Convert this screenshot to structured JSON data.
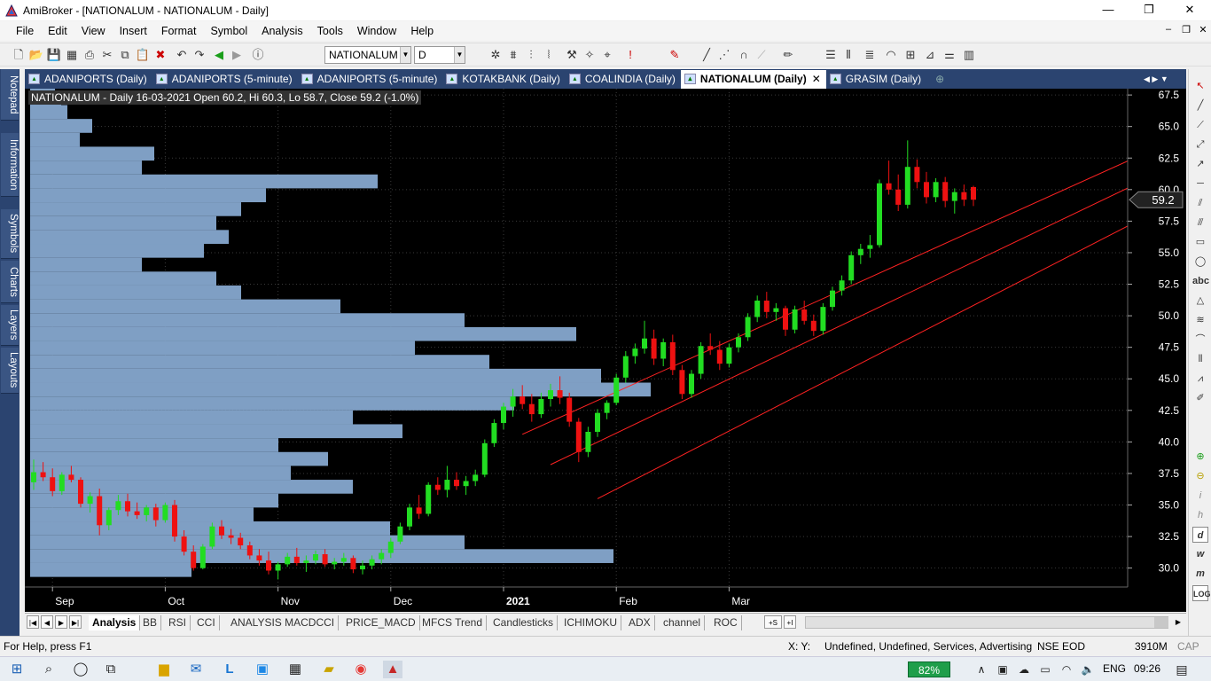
{
  "window": {
    "title": "AmiBroker - [NATIONALUM - NATIONALUM - Daily]",
    "minimize": "—",
    "maximize": "❐",
    "close": "✕"
  },
  "menu": [
    "File",
    "Edit",
    "View",
    "Insert",
    "Format",
    "Symbol",
    "Analysis",
    "Tools",
    "Window",
    "Help"
  ],
  "toolbar": {
    "symbol_value": "NATIONALUM",
    "interval_value": "D"
  },
  "left_panels": [
    "Notepad",
    "Information",
    "Symbols",
    "Charts",
    "Layouts",
    "Layers"
  ],
  "doc_tabs": [
    {
      "label": "ADANIPORTS (Daily)",
      "active": false
    },
    {
      "label": "ADANIPORTS (5-minute)",
      "active": false
    },
    {
      "label": "ADANIPORTS (5-minute)",
      "active": false
    },
    {
      "label": "KOTAKBANK (Daily)",
      "active": false
    },
    {
      "label": "COALINDIA (Daily)",
      "active": false
    },
    {
      "label": "NATIONALUM (Daily)",
      "active": true
    },
    {
      "label": "GRASIM (Daily)",
      "active": false
    }
  ],
  "chart": {
    "header": "NATIONALUM - Daily 16-03-2021 Open 60.2, Hi 60.3, Lo 58.7, Close 59.2 (-1.0%)",
    "last_price_label": "59.2"
  },
  "chart_data": {
    "type": "candlestick",
    "symbol": "NATIONALUM",
    "interval": "Daily",
    "ylim": [
      28.5,
      68.0
    ],
    "yticks": [
      30.0,
      32.5,
      35.0,
      37.5,
      40.0,
      42.5,
      45.0,
      47.5,
      50.0,
      52.5,
      55.0,
      57.5,
      60.0,
      62.5,
      65.0,
      67.5
    ],
    "ytick_labels": [
      "30.0",
      "32.5",
      "35.0",
      "37.5",
      "40.0",
      "42.5",
      "45.0",
      "47.5",
      "50.0",
      "52.5",
      "55.0",
      "57.5",
      "60.0",
      "62.5",
      "65.0",
      "67.5"
    ],
    "xtick_labels": [
      "Sep",
      "Oct",
      "Nov",
      "Dec",
      "2021",
      "Feb",
      "Mar"
    ],
    "xtick_bar_index": [
      2,
      14,
      26,
      38,
      50,
      62,
      74
    ],
    "last_close": 59.2,
    "grid": true,
    "colors": {
      "up": "#22dd22",
      "down": "#ee1111",
      "volume_profile": "#7f9fc4",
      "trend": "#ff2222",
      "background": "#000000"
    },
    "candles": [
      [
        36.8,
        38.6,
        36.2,
        37.6
      ],
      [
        37.6,
        38.4,
        36.9,
        37.2
      ],
      [
        37.2,
        37.9,
        35.7,
        36.1
      ],
      [
        36.1,
        37.6,
        35.8,
        37.4
      ],
      [
        37.4,
        38.1,
        36.8,
        37.0
      ],
      [
        37.0,
        37.2,
        34.8,
        35.1
      ],
      [
        35.1,
        36.0,
        34.4,
        35.7
      ],
      [
        35.7,
        36.3,
        32.6,
        33.4
      ],
      [
        33.4,
        34.8,
        33.0,
        34.6
      ],
      [
        34.6,
        35.8,
        34.2,
        35.3
      ],
      [
        35.3,
        35.9,
        34.1,
        34.5
      ],
      [
        34.5,
        35.2,
        33.9,
        34.2
      ],
      [
        34.2,
        35.0,
        33.7,
        34.8
      ],
      [
        34.8,
        35.1,
        33.3,
        33.8
      ],
      [
        33.8,
        35.2,
        33.6,
        35.0
      ],
      [
        35.0,
        35.4,
        32.1,
        32.5
      ],
      [
        32.5,
        33.0,
        31.0,
        31.3
      ],
      [
        31.3,
        31.8,
        29.8,
        30.0
      ],
      [
        30.0,
        31.9,
        29.9,
        31.7
      ],
      [
        31.7,
        33.6,
        31.5,
        33.3
      ],
      [
        33.3,
        33.8,
        32.3,
        32.6
      ],
      [
        32.6,
        33.1,
        31.9,
        32.4
      ],
      [
        32.4,
        32.8,
        31.5,
        31.8
      ],
      [
        31.8,
        32.1,
        30.7,
        31.0
      ],
      [
        31.0,
        31.5,
        30.2,
        30.6
      ],
      [
        30.6,
        31.3,
        29.5,
        29.8
      ],
      [
        29.8,
        30.5,
        29.1,
        30.3
      ],
      [
        30.3,
        31.2,
        30.1,
        30.9
      ],
      [
        30.9,
        31.6,
        30.2,
        30.4
      ],
      [
        30.4,
        31.0,
        29.7,
        30.6
      ],
      [
        30.6,
        31.4,
        30.3,
        31.1
      ],
      [
        31.1,
        31.5,
        30.1,
        30.3
      ],
      [
        30.3,
        30.8,
        29.9,
        30.5
      ],
      [
        30.5,
        31.2,
        30.2,
        30.8
      ],
      [
        30.8,
        31.0,
        29.6,
        29.9
      ],
      [
        29.9,
        30.6,
        29.5,
        30.2
      ],
      [
        30.2,
        31.0,
        29.9,
        30.7
      ],
      [
        30.7,
        31.5,
        30.3,
        31.2
      ],
      [
        31.2,
        32.4,
        30.8,
        32.1
      ],
      [
        32.1,
        33.6,
        31.9,
        33.3
      ],
      [
        33.3,
        35.1,
        33.0,
        34.8
      ],
      [
        34.8,
        35.8,
        33.9,
        34.3
      ],
      [
        34.3,
        36.8,
        34.1,
        36.6
      ],
      [
        36.6,
        37.2,
        35.8,
        36.2
      ],
      [
        36.2,
        38.1,
        35.6,
        37.0
      ],
      [
        37.0,
        37.6,
        36.2,
        36.5
      ],
      [
        36.5,
        37.3,
        35.8,
        36.9
      ],
      [
        36.9,
        37.8,
        36.5,
        37.4
      ],
      [
        37.4,
        40.2,
        37.2,
        39.9
      ],
      [
        39.9,
        41.8,
        39.6,
        41.5
      ],
      [
        41.5,
        43.1,
        41.0,
        42.8
      ],
      [
        42.8,
        44.2,
        42.0,
        43.6
      ],
      [
        43.6,
        44.5,
        42.6,
        43.0
      ],
      [
        43.0,
        43.8,
        41.6,
        42.2
      ],
      [
        42.2,
        43.9,
        41.9,
        43.4
      ],
      [
        43.4,
        44.6,
        42.8,
        44.1
      ],
      [
        44.1,
        45.2,
        43.0,
        43.5
      ],
      [
        43.5,
        43.9,
        41.2,
        41.6
      ],
      [
        41.6,
        41.9,
        38.4,
        39.2
      ],
      [
        39.2,
        41.2,
        38.8,
        40.8
      ],
      [
        40.8,
        42.6,
        40.4,
        42.3
      ],
      [
        42.3,
        43.3,
        41.8,
        43.1
      ],
      [
        43.1,
        45.4,
        42.9,
        45.1
      ],
      [
        45.1,
        47.2,
        44.7,
        46.8
      ],
      [
        46.8,
        47.8,
        46.2,
        47.4
      ],
      [
        47.4,
        49.6,
        47.0,
        48.2
      ],
      [
        48.2,
        48.9,
        46.1,
        46.6
      ],
      [
        46.6,
        48.2,
        46.0,
        47.9
      ],
      [
        47.9,
        48.5,
        45.3,
        45.7
      ],
      [
        45.7,
        46.1,
        43.4,
        43.8
      ],
      [
        43.8,
        45.7,
        43.5,
        45.4
      ],
      [
        45.4,
        47.9,
        45.0,
        47.6
      ],
      [
        47.6,
        48.6,
        46.9,
        47.3
      ],
      [
        47.3,
        48.0,
        45.7,
        46.2
      ],
      [
        46.2,
        47.8,
        45.9,
        47.5
      ],
      [
        47.5,
        48.6,
        47.1,
        48.3
      ],
      [
        48.3,
        50.2,
        48.0,
        49.9
      ],
      [
        49.9,
        51.6,
        49.5,
        51.2
      ],
      [
        51.2,
        51.9,
        49.8,
        50.3
      ],
      [
        50.3,
        51.0,
        49.6,
        50.6
      ],
      [
        50.6,
        50.8,
        48.4,
        48.9
      ],
      [
        48.9,
        50.8,
        48.6,
        50.5
      ],
      [
        50.5,
        51.2,
        49.3,
        49.6
      ],
      [
        49.6,
        50.1,
        48.4,
        48.8
      ],
      [
        48.8,
        51.0,
        48.5,
        50.7
      ],
      [
        50.7,
        52.3,
        50.4,
        52.0
      ],
      [
        52.0,
        53.2,
        51.6,
        52.8
      ],
      [
        52.8,
        55.1,
        52.5,
        54.8
      ],
      [
        54.8,
        55.7,
        54.1,
        55.3
      ],
      [
        55.3,
        56.4,
        54.6,
        55.6
      ],
      [
        55.6,
        60.8,
        55.4,
        60.5
      ],
      [
        60.5,
        62.3,
        59.6,
        60.0
      ],
      [
        60.0,
        61.2,
        58.3,
        58.8
      ],
      [
        58.8,
        63.9,
        58.5,
        61.8
      ],
      [
        61.8,
        62.4,
        60.1,
        60.6
      ],
      [
        60.6,
        61.4,
        58.9,
        59.4
      ],
      [
        59.4,
        60.9,
        59.0,
        60.6
      ],
      [
        60.6,
        61.0,
        58.6,
        59.1
      ],
      [
        59.1,
        60.1,
        58.1,
        59.8
      ],
      [
        59.8,
        60.4,
        58.7,
        59.2
      ],
      [
        60.2,
        60.3,
        58.7,
        59.2
      ]
    ],
    "volume_profile": {
      "bin_low": 29.3,
      "bin_step": 1.1,
      "widths": [
        0.26,
        0.94,
        0.7,
        0.58,
        0.36,
        0.4,
        0.52,
        0.42,
        0.48,
        0.4,
        0.6,
        0.52,
        0.78,
        1.0,
        0.92,
        0.74,
        0.62,
        0.88,
        0.7,
        0.5,
        0.34,
        0.3,
        0.18,
        0.28,
        0.32,
        0.3,
        0.34,
        0.38,
        0.56,
        0.18,
        0.2,
        0.08,
        0.1,
        0.06,
        0.05,
        0.04
      ]
    },
    "trendlines": [
      {
        "x0": 52,
        "y0": 40.6,
        "x1": 129,
        "y1": 66.5
      },
      {
        "x0": 55,
        "y0": 38.2,
        "x1": 127,
        "y1": 63.9
      },
      {
        "x0": 60,
        "y0": 35.5,
        "x1": 119,
        "y1": 58.1
      }
    ],
    "triangle": [
      [
        117,
        62.2
      ],
      [
        131,
        59.6
      ],
      [
        117,
        55.6
      ]
    ]
  },
  "sheet_tabs": [
    "Analysis",
    "BB",
    "RSI",
    "CCI",
    "ANALYSIS MACDCCI",
    "PRICE_MACD",
    "MFCS Trend",
    "Candlesticks",
    "ICHIMOKU",
    "ADX",
    "channel",
    "ROC"
  ],
  "status": {
    "help": "For Help, press F1",
    "xy": "X:   Y:",
    "category": "Undefined, Undefined, Services, Advertising",
    "source": "NSE EOD",
    "memory": "3910M",
    "cap": "CAP"
  },
  "taskbar": {
    "battery": "82%",
    "lang": "ENG",
    "time": "09:26"
  }
}
